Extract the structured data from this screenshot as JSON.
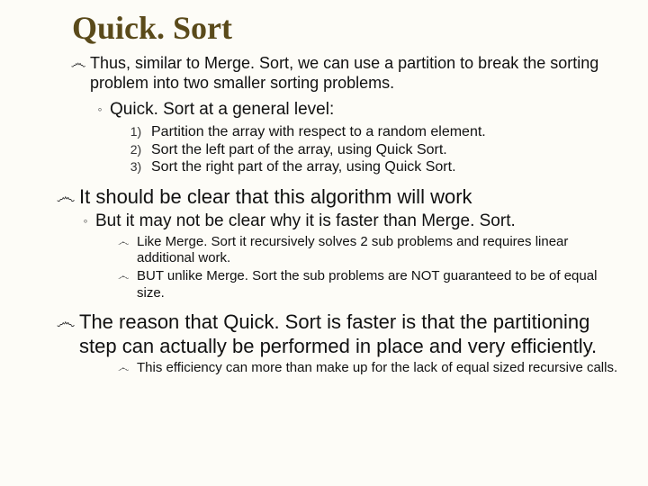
{
  "title": "Quick. Sort",
  "p1": "Thus, similar to Merge. Sort, we can use a partition to break the sorting problem into two smaller sorting problems.",
  "p2": "Quick. Sort at a general level:",
  "steps": {
    "n1": "1)",
    "t1": "Partition the array with respect to a random element.",
    "n2": "2)",
    "t2": "Sort the left part of the array, using Quick Sort.",
    "n3": "3)",
    "t3": "Sort the right part of the array, using Quick Sort."
  },
  "p3": "It should be clear that this algorithm will work",
  "p4": "But it may not be clear why it is faster than Merge. Sort.",
  "p5": "Like Merge. Sort it recursively solves 2 sub problems and requires linear additional work.",
  "p6": "BUT unlike Merge. Sort the sub problems are NOT guaranteed to be of equal size.",
  "p7": "The reason that Quick. Sort is faster is that the partitioning step can actually be performed in place and very efficiently.",
  "p8": "This efficiency can more than make up for the lack of equal sized recursive calls.",
  "bullets": {
    "swirl": "෴",
    "circ": "◦"
  }
}
